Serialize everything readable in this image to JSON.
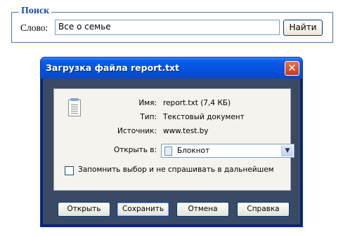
{
  "search": {
    "legend": "Поиск",
    "label": "Слово:",
    "value": "Все о семье",
    "button": "Найти"
  },
  "dialog": {
    "title": "Загрузка файла report.txt",
    "file_icon": "notepad-file-icon",
    "rows": [
      {
        "label": "Имя:",
        "value": "report.txt (7,4 КБ)"
      },
      {
        "label": "Тип:",
        "value": "Текстовый документ"
      },
      {
        "label": "Источник:",
        "value": "www.test.by"
      }
    ],
    "open_with_label": "Открыть в:",
    "open_with_value": "Блокнот",
    "remember_label": "Запомнить выбор и не спрашивать в дальнейшем",
    "remember_checked": false,
    "buttons": {
      "open": "Открыть",
      "save": "Сохранить",
      "cancel": "Отмена",
      "help": "Справка"
    },
    "colors": {
      "title_bar": "#0550dc",
      "frame": "#3b4a64",
      "close_button": "#c7381e"
    }
  }
}
